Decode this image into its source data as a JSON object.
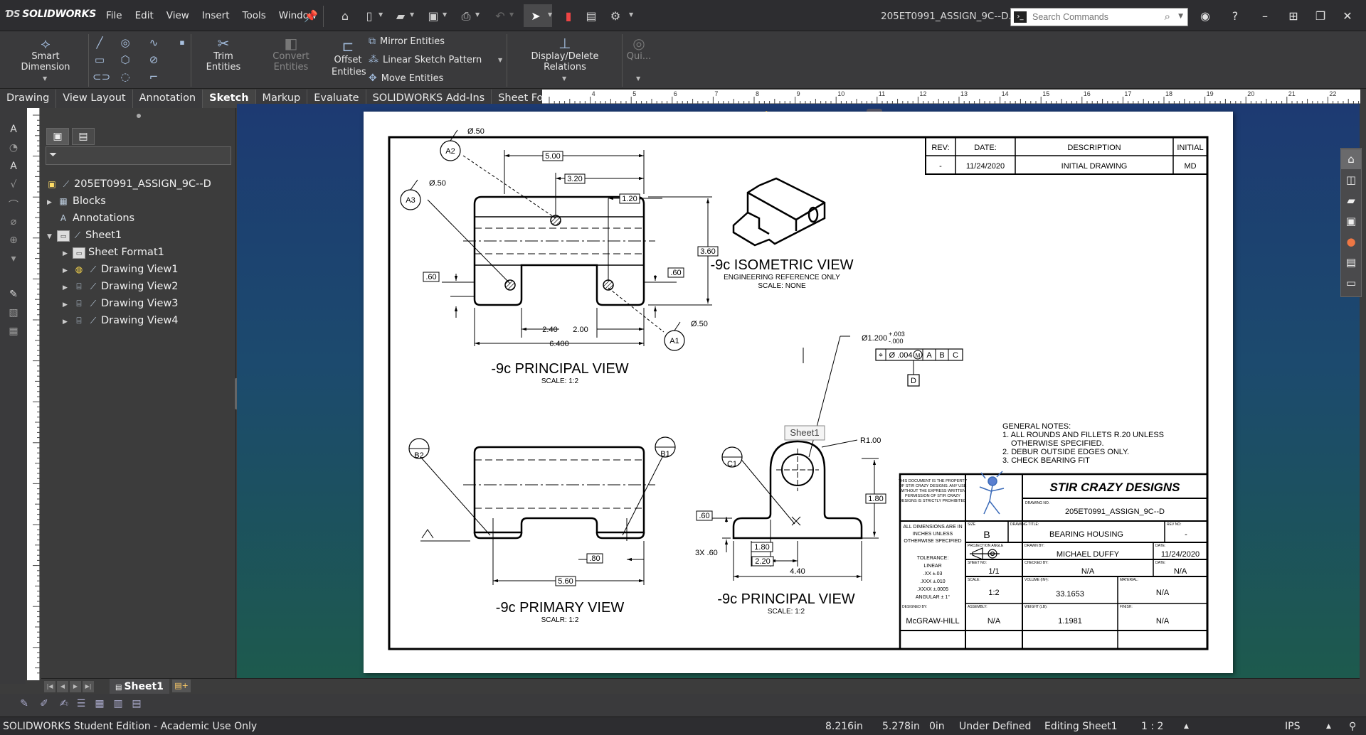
{
  "app": {
    "logo": "SOLIDWORKS",
    "doc_title": "205ET0991_ASSIGN_9C--D..."
  },
  "menu": [
    "File",
    "Edit",
    "View",
    "Insert",
    "Tools",
    "Window"
  ],
  "search": {
    "placeholder": "Search Commands"
  },
  "ribbon": {
    "smart_dimension": "Smart Dimension",
    "trim_entities": "Trim Entities",
    "convert_entities": "Convert Entities",
    "offset_entities_1": "Offset",
    "offset_entities_2": "Entities",
    "mirror_entities": "Mirror Entities",
    "linear_sketch_pattern": "Linear Sketch Pattern",
    "move_entities": "Move Entities",
    "display_delete_relations": "Display/Delete Relations",
    "quick_snaps": "Qui..."
  },
  "tabs": [
    "Drawing",
    "View Layout",
    "Annotation",
    "Sketch",
    "Markup",
    "Evaluate",
    "SOLIDWORKS Add-Ins",
    "Sheet Format"
  ],
  "active_tab": "Sketch",
  "tree": {
    "root": "205ET0991_ASSIGN_9C--D",
    "items": [
      "Blocks",
      "Annotations",
      "Sheet1",
      "Sheet Format1",
      "Drawing View1",
      "Drawing View2",
      "Drawing View3",
      "Drawing View4"
    ]
  },
  "drawing": {
    "rev_table": {
      "headers": [
        "REV:",
        "DATE:",
        "DESCRIPTION",
        "INITIAL"
      ],
      "row": [
        "-",
        "11/24/2020",
        "INITIAL DRAWING",
        "MD"
      ]
    },
    "views": {
      "principal_top": {
        "title": "-9c PRINCIPAL VIEW",
        "scale": "SCALE: 1:2"
      },
      "isometric": {
        "title": "-9c ISOMETRIC VIEW",
        "sub": "ENGINEERING REFERENCE ONLY",
        "scale": "SCALE: NONE"
      },
      "primary": {
        "title": "-9c PRIMARY VIEW",
        "scale": "SCALR: 1:2"
      },
      "principal_bottom": {
        "title": "-9c PRINCIPAL VIEW",
        "scale": "SCALE: 1:2"
      }
    },
    "dims_top": {
      "d500": "5.00",
      "d320": "3.20",
      "d120": "1.20",
      "d360": "3.60",
      "d60a": ".60",
      "d60b": ".60",
      "d240": "2.40",
      "d200": "2.00",
      "d6400": "6.400",
      "phi50a": "Ø.50",
      "phi50b": "Ø.50",
      "phi50c": "Ø.50",
      "a1": "A1",
      "a2": "A2",
      "a3": "A3"
    },
    "dims_primary": {
      "d80": ".80",
      "d560": "5.60",
      "b1": "B1",
      "b2": "B2"
    },
    "dims_bottom": {
      "hole": "Ø1.200",
      "tol_plus": "+.003",
      "tol_minus": "-.000",
      "fcf_pos": "⌖",
      "fcf_tol": "Ø .004",
      "fcf_m": "M",
      "fcf_a": "A",
      "fcf_b": "B",
      "fcf_c": "C",
      "datum_d": "D",
      "r100": "R1.00",
      "d60": ".60",
      "three_x": "3X .60",
      "d180a": "1.80",
      "d180b": "1.80",
      "d220": "2.20",
      "d440": "4.40",
      "c1": "C1"
    },
    "tooltip": "Sheet1",
    "notes": [
      "GENERAL NOTES:",
      "1. ALL ROUNDS AND FILLETS R.20 UNLESS",
      "OTHERWISE SPECIFIED.",
      "2. DEBUR OUTSIDE EDGES ONLY.",
      "3. CHECK BEARING FIT"
    ],
    "title_block": {
      "property_note": [
        "THIS DOCUMENT IS THE PROPERTY",
        "OF STIR CRAZY DESIGNS. ANY USE",
        "WITHOUT THE EXPRESS WRITTEN",
        "PERMISSION OF STIR CRAZY",
        "DESIGNS IS STRICTLY PROHIBITED"
      ],
      "company": "STIR CRAZY DESIGNS",
      "drawing_no_label": "DRAWING NO.",
      "drawing_no": "205ET0991_ASSIGN_9C--D",
      "dims_note": [
        "ALL DIMENSIONS ARE IN",
        "INCHES UNLESS",
        "OTHERWISE SPECIFIED"
      ],
      "tolerance": [
        "TOLERANCE:",
        "LINEAR",
        ".XX ±.03",
        ".XXX ±.010",
        ".XXXX ±.0005",
        "ANGULAR ± 1°"
      ],
      "size_label": "SIZE",
      "size": "B",
      "title_label": "DRAWING TITLE:",
      "title": "BEARING HOUSING",
      "rev_label": "REV NO:",
      "rev": "-",
      "proj_label": "PROJECTION ANGLE",
      "drawn_label": "DRAWN BY:",
      "drawn": "MICHAEL DUFFY",
      "date_label": "DATE:",
      "date": "11/24/2020",
      "sheet_label": "SHEET NO:",
      "sheet": "1/1",
      "checked_label": "CHECKED BY:",
      "checked": "N/A",
      "date2_label": "DATE:",
      "date2": "N/A",
      "scale_label": "SCALE:",
      "scale": "1:2",
      "volume_label": "VOLUME (IN³):",
      "volume": "33.1653",
      "material_label": "MATERIAL:",
      "material": "N/A",
      "designed_label": "DESIGNED BY:",
      "designed": "McGRAW-HILL",
      "assembly_label": "ASSEMBLY:",
      "assembly": "N/A",
      "weight_label": "WEIGHT (LB):",
      "weight": "1.1981",
      "finish_label": "FINISH:",
      "finish": "N/A"
    }
  },
  "sheet_tab": "Sheet1",
  "status": {
    "edition": "SOLIDWORKS Student Edition - Academic Use Only",
    "x": "8.216in",
    "y": "5.278in",
    "z": "0in",
    "state": "Under Defined",
    "editing": "Editing Sheet1",
    "scale": "1 : 2",
    "units": "IPS"
  }
}
